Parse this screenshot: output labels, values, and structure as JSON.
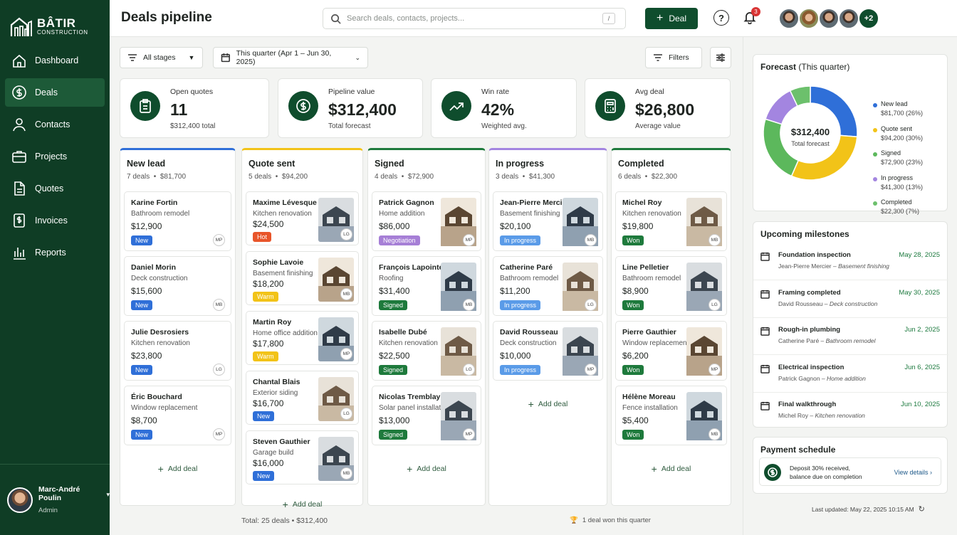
{
  "brand": {
    "name": "BÂTIR",
    "sub": "CONSTRUCTION"
  },
  "nav": [
    {
      "label": "Dashboard",
      "icon": "home-icon"
    },
    {
      "label": "Deals",
      "icon": "dollar-icon",
      "active": true
    },
    {
      "label": "Contacts",
      "icon": "person-icon"
    },
    {
      "label": "Projects",
      "icon": "briefcase-icon"
    },
    {
      "label": "Quotes",
      "icon": "document-icon"
    },
    {
      "label": "Invoices",
      "icon": "invoice-icon"
    },
    {
      "label": "Reports",
      "icon": "bar-chart-icon"
    }
  ],
  "user": {
    "name": "Marc-André Poulin",
    "role": "Admin"
  },
  "topbar": {
    "title": "Deals pipeline",
    "search_placeholder": "Search deals, contacts, projects...",
    "search_shortcut": "/",
    "deal_button": "Deal",
    "notifications": "3",
    "more_members": "+2"
  },
  "filters": {
    "stages": "All stages",
    "period": "This quarter (Apr 1 – Jun 30, 2025)",
    "filters": "Filters"
  },
  "stats": [
    {
      "label": "Open quotes",
      "value": "11",
      "sub": "$312,400 total",
      "icon": "clipboard-icon"
    },
    {
      "label": "Pipeline value",
      "value": "$312,400",
      "sub": "Total forecast",
      "icon": "dollar-circle-icon"
    },
    {
      "label": "Win rate",
      "value": "42%",
      "sub": "Weighted avg.",
      "icon": "trend-up-icon"
    },
    {
      "label": "Avg deal",
      "value": "$26,800",
      "sub": "Average value",
      "icon": "calculator-icon"
    }
  ],
  "columns": [
    {
      "title": "New lead",
      "count": "7 deals",
      "total": "$81,700",
      "color": "#2f6fd8",
      "add": "Add deal",
      "cards": [
        {
          "name": "Karine Fortin",
          "desc": "Bathroom remodel",
          "amount": "$12,900",
          "tag": "New",
          "tag_color": "#2f6fd8",
          "initials": "MP"
        },
        {
          "name": "Daniel Morin",
          "desc": "Deck construction",
          "amount": "$15,600",
          "tag": "New",
          "tag_color": "#2f6fd8",
          "initials": "MB"
        },
        {
          "name": "Julie Desrosiers",
          "desc": "Kitchen renovation",
          "amount": "$23,800",
          "tag": "New",
          "tag_color": "#2f6fd8",
          "initials": "LG"
        },
        {
          "name": "Éric Bouchard",
          "desc": "Window replacement",
          "amount": "$8,700",
          "tag": "New",
          "tag_color": "#2f6fd8",
          "initials": "MP"
        }
      ]
    },
    {
      "title": "Quote sent",
      "count": "5 deals",
      "total": "$94,200",
      "color": "#f2c318",
      "add": "Add deal",
      "cards": [
        {
          "name": "Maxime Lévesque",
          "desc": "Kitchen renovation",
          "amount": "$24,500",
          "tag": "Hot",
          "tag_color": "#e8552a",
          "initials": "LG"
        },
        {
          "name": "Sophie Lavoie",
          "desc": "Basement finishing",
          "amount": "$18,200",
          "tag": "Warm",
          "tag_color": "#f2c318",
          "initials": "MB"
        },
        {
          "name": "Martin Roy",
          "desc": "Home office addition",
          "amount": "$17,800",
          "tag": "Warm",
          "tag_color": "#f2c318",
          "initials": "MP"
        },
        {
          "name": "Chantal Blais",
          "desc": "Exterior siding",
          "amount": "$16,700",
          "tag": "New",
          "tag_color": "#2f6fd8",
          "initials": "LG"
        },
        {
          "name": "Steven Gauthier",
          "desc": "Garage build",
          "amount": "$16,000",
          "tag": "New",
          "tag_color": "#2f6fd8",
          "initials": "MB"
        }
      ]
    },
    {
      "title": "Signed",
      "count": "4 deals",
      "total": "$72,900",
      "color": "#1e7a3c",
      "add": "Add deal",
      "cards": [
        {
          "name": "Patrick Gagnon",
          "desc": "Home addition",
          "amount": "$86,000",
          "tag": "Negotiation",
          "tag_color": "#a67fd6",
          "initials": "MP"
        },
        {
          "name": "François Lapointe",
          "desc": "Roofing",
          "amount": "$31,400",
          "tag": "Signed",
          "tag_color": "#1e7a3c",
          "initials": "MB"
        },
        {
          "name": "Isabelle Dubé",
          "desc": "Kitchen renovation",
          "amount": "$22,500",
          "tag": "Signed",
          "tag_color": "#1e7a3c",
          "initials": "LG"
        },
        {
          "name": "Nicolas Tremblay",
          "desc": "Solar panel installation",
          "amount": "$13,000",
          "tag": "Signed",
          "tag_color": "#1e7a3c",
          "initials": "MP"
        }
      ]
    },
    {
      "title": "In progress",
      "count": "3 deals",
      "total": "$41,300",
      "color": "#a385e0",
      "add": "Add deal",
      "cards": [
        {
          "name": "Jean-Pierre Mercier",
          "desc": "Basement finishing",
          "amount": "$20,100",
          "tag": "In progress",
          "tag_color": "#5a9be8",
          "initials": "MB"
        },
        {
          "name": "Catherine Paré",
          "desc": "Bathroom remodel",
          "amount": "$11,200",
          "tag": "In progress",
          "tag_color": "#5a9be8",
          "initials": "LG"
        },
        {
          "name": "David Rousseau",
          "desc": "Deck construction",
          "amount": "$10,000",
          "tag": "In progress",
          "tag_color": "#5a9be8",
          "initials": "MP"
        }
      ]
    },
    {
      "title": "Completed",
      "count": "6 deals",
      "total": "$22,300",
      "color": "#1e7a3c",
      "add": "Add deal",
      "cards": [
        {
          "name": "Michel Roy",
          "desc": "Kitchen renovation",
          "amount": "$19,800",
          "tag": "Won",
          "tag_color": "#1e7a3c",
          "initials": "MB"
        },
        {
          "name": "Line Pelletier",
          "desc": "Bathroom remodel",
          "amount": "$8,900",
          "tag": "Won",
          "tag_color": "#1e7a3c",
          "initials": "LG"
        },
        {
          "name": "Pierre Gauthier",
          "desc": "Window replacement",
          "amount": "$6,200",
          "tag": "Won",
          "tag_color": "#1e7a3c",
          "initials": "MP"
        },
        {
          "name": "Hélène Moreau",
          "desc": "Fence installation",
          "amount": "$5,400",
          "tag": "Won",
          "tag_color": "#1e7a3c",
          "initials": "MB"
        }
      ]
    }
  ],
  "footer": {
    "total": "Total: 25 deals  •  $312,400",
    "won": "1 deal won this quarter"
  },
  "forecast": {
    "title": "Forecast",
    "period": "(This quarter)",
    "center_value": "$312,400",
    "center_label": "Total forecast",
    "chart_data": {
      "type": "pie",
      "categories": [
        "New lead",
        "Quote sent",
        "Signed",
        "In progress",
        "Completed"
      ],
      "values": [
        26,
        30,
        23,
        13,
        7
      ],
      "amounts": [
        "$81,700 (26%)",
        "$94,200 (30%)",
        "$72,900 (23%)",
        "$41,300 (13%)",
        "$22,300 (7%)"
      ],
      "colors": [
        "#2f6fd8",
        "#f2c318",
        "#5cb85c",
        "#a385e0",
        "#6cc06c"
      ]
    }
  },
  "milestones": {
    "title": "Upcoming milestones",
    "items": [
      {
        "title": "Foundation inspection",
        "date": "May 28, 2025",
        "person": "Jean-Pierre Mercier",
        "project": "Basement finishing"
      },
      {
        "title": "Framing completed",
        "date": "May 30, 2025",
        "person": "David Rousseau",
        "project": "Deck construction"
      },
      {
        "title": "Rough-in plumbing",
        "date": "Jun 2, 2025",
        "person": "Catherine Paré",
        "project": "Bathroom remodel"
      },
      {
        "title": "Electrical inspection",
        "date": "Jun 6, 2025",
        "person": "Patrick Gagnon",
        "project": "Home addition"
      },
      {
        "title": "Final walkthrough",
        "date": "Jun 10, 2025",
        "person": "Michel Roy",
        "project": "Kitchen renovation"
      }
    ]
  },
  "payment": {
    "title": "Payment schedule",
    "text": "Deposit 30% received, balance due on completion",
    "link": "View details"
  },
  "updated": "Last updated: May 22, 2025 10:15 AM"
}
